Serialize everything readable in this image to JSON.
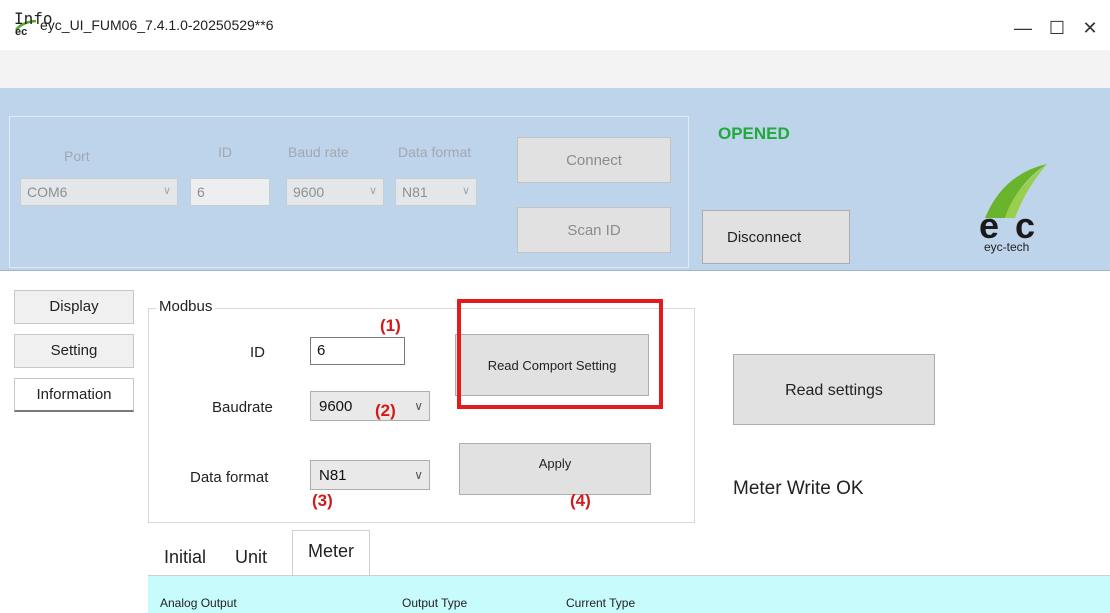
{
  "window": {
    "title": "eyc_UI_FUM06_7.4.1.0-20250529**6",
    "controls": {
      "minimize": "—",
      "maximize": "☐",
      "close": "✕"
    }
  },
  "menu": {
    "info": "Info"
  },
  "connection": {
    "port": {
      "label": "Port",
      "value": "COM6"
    },
    "id": {
      "label": "ID",
      "value": "6"
    },
    "baud": {
      "label": "Baud rate",
      "value": "9600"
    },
    "format": {
      "label": "Data format",
      "value": "N81"
    },
    "connect_label": "Connect",
    "scan_label": "Scan ID",
    "status": "OPENED",
    "disconnect_label": "Disconnect"
  },
  "logo": {
    "caption": "eyc-tech"
  },
  "side_tabs": [
    "Display",
    "Setting",
    "Information"
  ],
  "modbus": {
    "legend": "Modbus",
    "id_label": "ID",
    "id_value": "6",
    "baud_label": "Baudrate",
    "baud_value": "9600",
    "format_label": "Data format",
    "format_value": "N81",
    "read_comport_label": "Read Comport Setting",
    "apply_label": "Apply"
  },
  "annotations": [
    "(1)",
    "(2)",
    "(3)",
    "(4)"
  ],
  "read_settings_label": "Read settings",
  "meter_status": "Meter Write OK",
  "bottom_tabs": [
    "Initial",
    "Unit",
    "Meter"
  ],
  "meter_columns": [
    "Analog Output",
    "Output Type",
    "Current Type"
  ],
  "colors": {
    "status_green": "#1faa3b",
    "highlight_red": "#e21c1c",
    "panel_cyan": "#c8fcfc",
    "header_blue": "#bed4ea"
  }
}
